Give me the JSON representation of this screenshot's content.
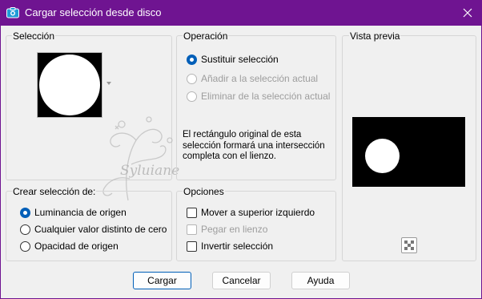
{
  "window": {
    "title": "Cargar selección desde disco"
  },
  "seleccion": {
    "legend": "Selección"
  },
  "operacion": {
    "legend": "Operación",
    "options": [
      {
        "label": "Sustituir selección",
        "checked": true,
        "disabled": false
      },
      {
        "label": "Añadir a la selección actual",
        "checked": false,
        "disabled": true
      },
      {
        "label": "Eliminar de la selección actual",
        "checked": false,
        "disabled": true
      }
    ],
    "info": "El rectángulo original de esta selección formará una intersección completa con el lienzo."
  },
  "vista_previa": {
    "legend": "Vista previa"
  },
  "crear": {
    "legend": "Crear selección de:",
    "options": [
      {
        "label": "Luminancia de origen",
        "checked": true
      },
      {
        "label": "Cualquier valor distinto de cero",
        "checked": false
      },
      {
        "label": "Opacidad de origen",
        "checked": false
      }
    ]
  },
  "opciones": {
    "legend": "Opciones",
    "items": [
      {
        "label": "Mover a superior izquierdo",
        "checked": false,
        "disabled": false
      },
      {
        "label": "Pegar en lienzo",
        "checked": false,
        "disabled": true
      },
      {
        "label": "Invertir selección",
        "checked": false,
        "disabled": false
      }
    ]
  },
  "buttons": {
    "load": "Cargar",
    "cancel": "Cancelar",
    "help": "Ayuda"
  },
  "watermark": "Syluiane",
  "colors": {
    "titlebar": "#6f1491",
    "accent": "#005fb8"
  }
}
